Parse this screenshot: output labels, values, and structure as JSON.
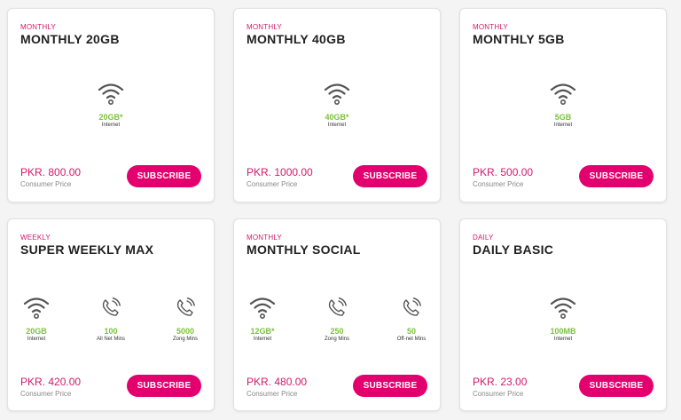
{
  "consumer_price_label": "Consumer Price",
  "subscribe_label": "SUBSCRIBE",
  "plans": [
    {
      "category": "MONTHLY",
      "name": "MONTHLY 20GB",
      "price": "PKR. 800.00",
      "features": [
        {
          "icon": "wifi-icon",
          "value": "20GB*",
          "label": "Internet"
        }
      ]
    },
    {
      "category": "MONTHLY",
      "name": "MONTHLY 40GB",
      "price": "PKR. 1000.00",
      "features": [
        {
          "icon": "wifi-icon",
          "value": "40GB*",
          "label": "Internet"
        }
      ]
    },
    {
      "category": "MONTHLY",
      "name": "MONTHLY 5GB",
      "price": "PKR. 500.00",
      "features": [
        {
          "icon": "wifi-icon",
          "value": "5GB",
          "label": "Internet"
        }
      ]
    },
    {
      "category": "WEEKLY",
      "name": "SUPER WEEKLY MAX",
      "price": "PKR. 420.00",
      "features": [
        {
          "icon": "wifi-icon",
          "value": "20GB",
          "label": "Internet"
        },
        {
          "icon": "phone-icon",
          "value": "100",
          "label": "All Net Mins"
        },
        {
          "icon": "phone-icon",
          "value": "5000",
          "label": "Zong Mins"
        }
      ]
    },
    {
      "category": "MONTHLY",
      "name": "MONTHLY SOCIAL",
      "price": "PKR. 480.00",
      "features": [
        {
          "icon": "wifi-icon",
          "value": "12GB*",
          "label": "Internet"
        },
        {
          "icon": "phone-icon",
          "value": "250",
          "label": "Zong Mins"
        },
        {
          "icon": "phone-icon",
          "value": "50",
          "label": "Off-net Mins"
        }
      ]
    },
    {
      "category": "DAILY",
      "name": "DAILY BASIC",
      "price": "PKR. 23.00",
      "features": [
        {
          "icon": "wifi-icon",
          "value": "100MB",
          "label": "Internet"
        }
      ]
    }
  ],
  "colors": {
    "accent": "#e3006e",
    "category": "#d4196c",
    "value": "#7cc23a"
  }
}
